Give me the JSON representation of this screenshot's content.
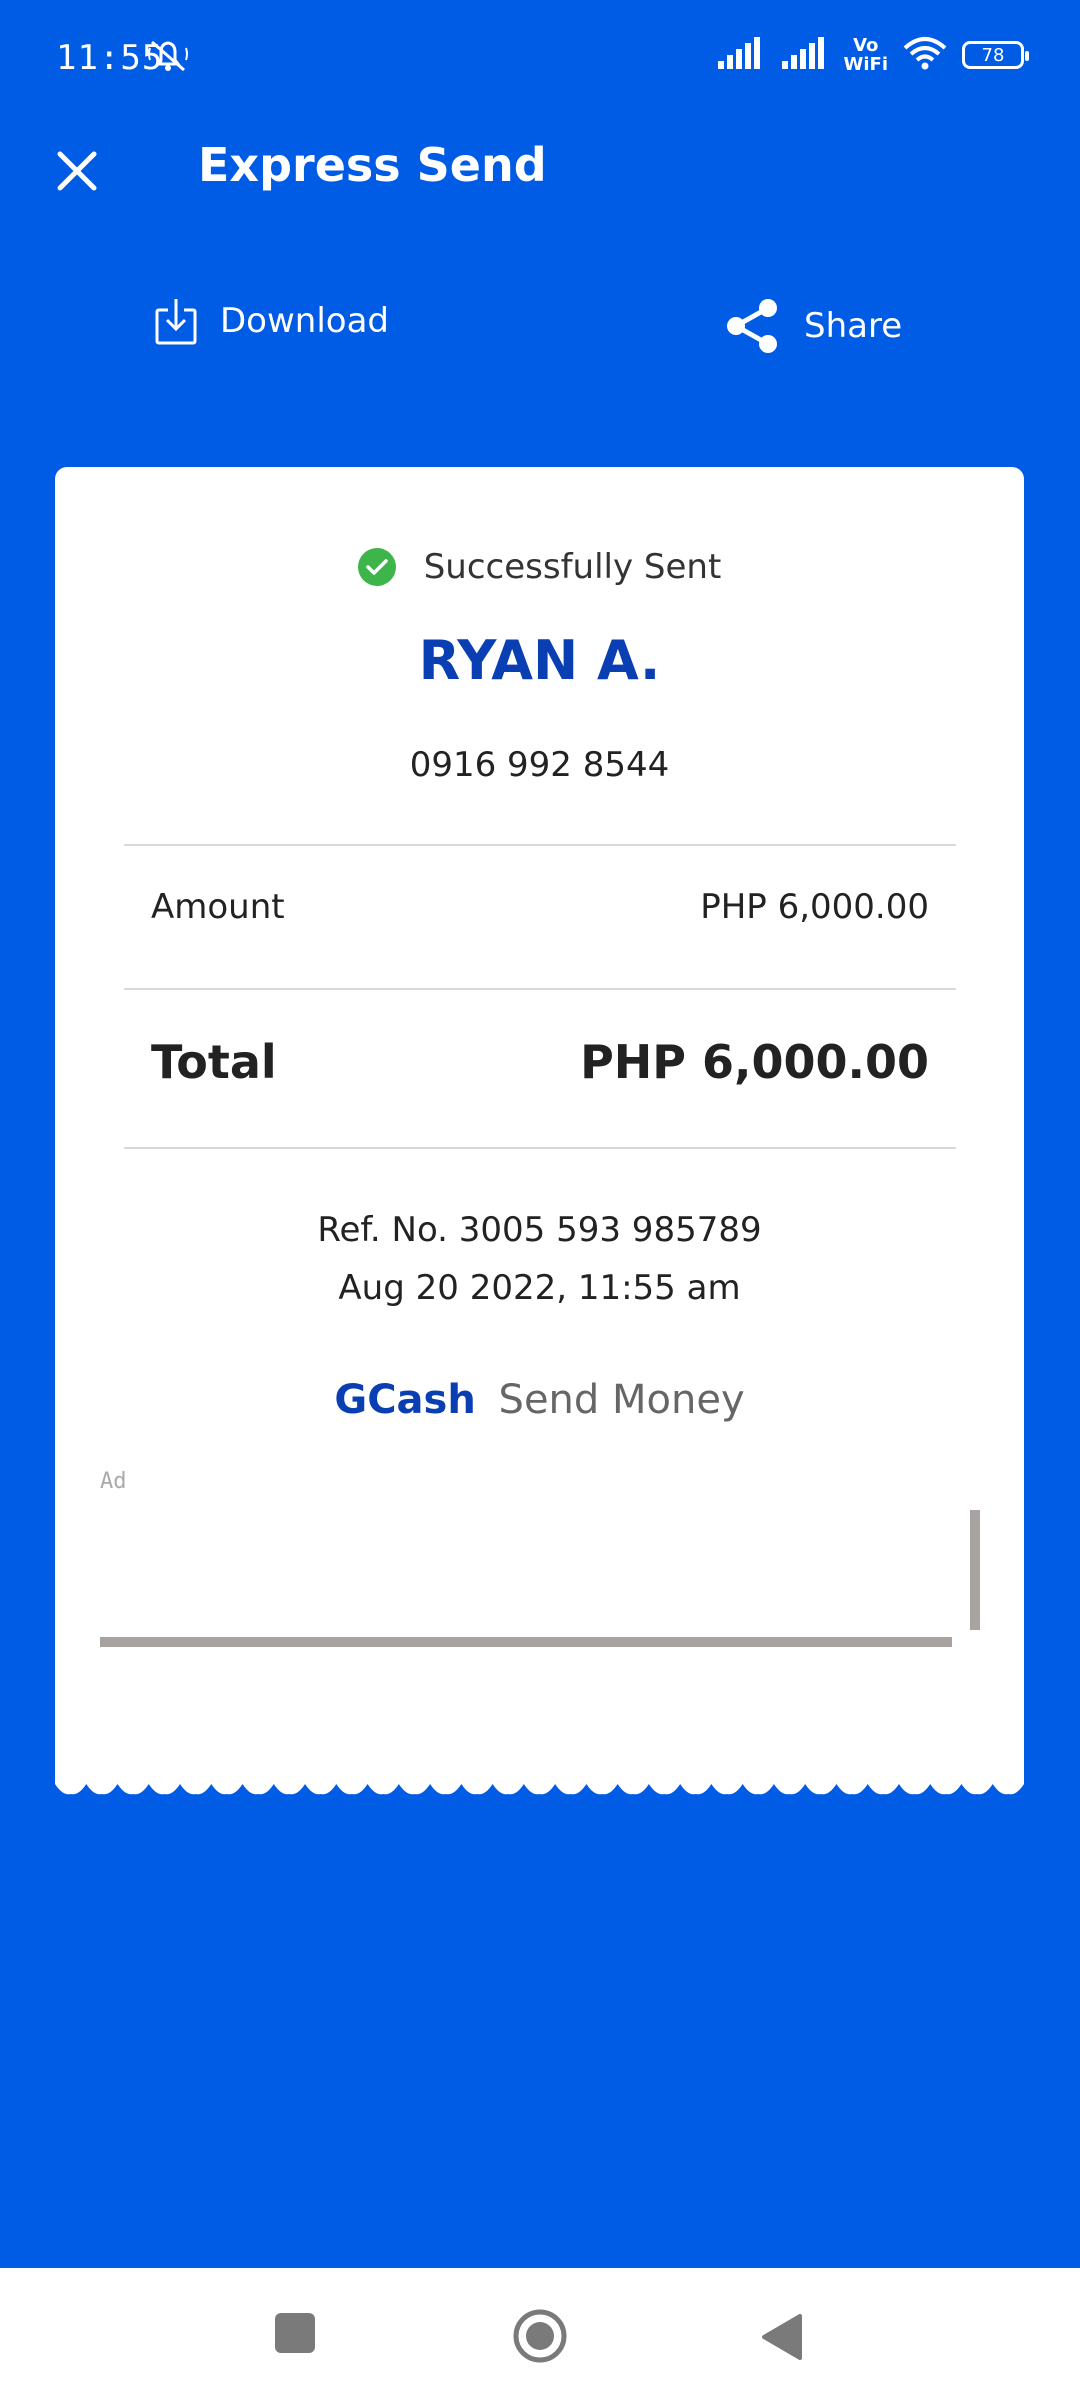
{
  "status_bar": {
    "time": "11:55",
    "vowifi_top": "Vo",
    "vowifi_bottom": "WiFi",
    "battery": "78"
  },
  "header": {
    "title": "Express Send"
  },
  "actions": {
    "download_label": "Download",
    "share_label": "Share"
  },
  "receipt": {
    "status_text": "Successfully Sent",
    "recipient_name": "RYAN A.",
    "recipient_number": "0916 992 8544",
    "amount_label": "Amount",
    "amount_value": "PHP 6,000.00",
    "total_label": "Total",
    "total_value": "PHP 6,000.00",
    "ref_no": "Ref. No. 3005 593 985789",
    "datetime": "Aug 20 2022, 11:55 am",
    "brand_name": "GCash",
    "brand_sub": "Send Money",
    "ad_label": "Ad"
  },
  "colors": {
    "primary": "#005CE5",
    "brand_text": "#0A3FB4",
    "success": "#3DB54A"
  },
  "icons": [
    "bell-off-icon",
    "signal-icon",
    "wifi-icon",
    "battery-icon",
    "close-icon",
    "download-icon",
    "share-icon",
    "check-circle-icon",
    "nav-recent-icon",
    "nav-home-icon",
    "nav-back-icon"
  ]
}
